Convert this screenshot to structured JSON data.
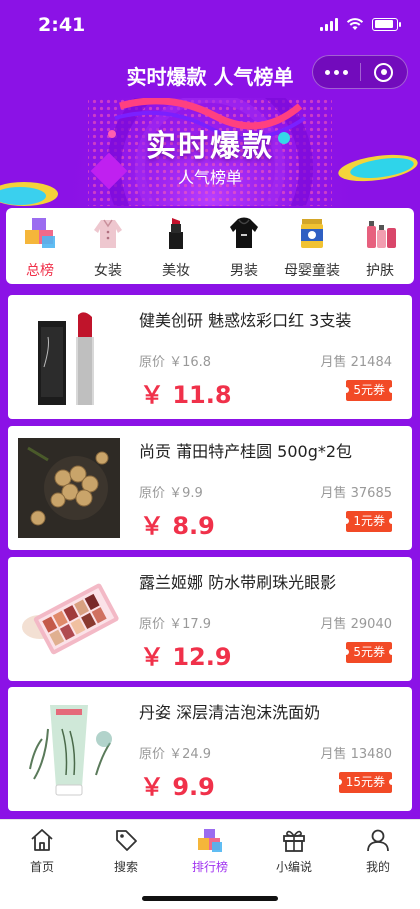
{
  "status_bar": {
    "time": "2:41"
  },
  "nav": {
    "title": "实时爆款 人气榜单"
  },
  "banner": {
    "title": "实时爆款",
    "subtitle": "人气榜单"
  },
  "categories": [
    {
      "label": "总榜",
      "active": true,
      "icon": "boxes-icon"
    },
    {
      "label": "女装",
      "active": false,
      "icon": "coat-icon"
    },
    {
      "label": "美妆",
      "active": false,
      "icon": "lipstick-icon"
    },
    {
      "label": "男装",
      "active": false,
      "icon": "hoodie-icon"
    },
    {
      "label": "母婴童装",
      "active": false,
      "icon": "formula-can-icon"
    },
    {
      "label": "护肤",
      "active": false,
      "icon": "bottles-icon"
    }
  ],
  "products": [
    {
      "name": "健美创研 魅惑炫彩口红 3支装",
      "original": "原价 ￥16.8",
      "sales": "月售 21484",
      "price": "￥ 11.8",
      "coupon": "5元券",
      "image": "lipstick-image"
    },
    {
      "name": "尚贡 莆田特产桂圆 500g*2包",
      "original": "原价 ￥9.9",
      "sales": "月售 37685",
      "price": "￥ 8.9",
      "coupon": "1元券",
      "image": "longan-image"
    },
    {
      "name": "露兰姬娜 防水带刷珠光眼影",
      "original": "原价 ￥17.9",
      "sales": "月售 29040",
      "price": "￥ 12.9",
      "coupon": "5元券",
      "image": "eyeshadow-palette-image"
    },
    {
      "name": "丹姿 深层清洁泡沫洗面奶",
      "original": "原价 ￥24.9",
      "sales": "月售 13480",
      "price": "￥ 9.9",
      "coupon": "15元券",
      "image": "facial-cleanser-image"
    }
  ],
  "tabs": [
    {
      "label": "首页",
      "active": false,
      "icon": "home-icon"
    },
    {
      "label": "搜索",
      "active": false,
      "icon": "tag-icon"
    },
    {
      "label": "排行榜",
      "active": true,
      "icon": "ranking-icon"
    },
    {
      "label": "小编说",
      "active": false,
      "icon": "gift-icon"
    },
    {
      "label": "我的",
      "active": false,
      "icon": "user-icon"
    }
  ],
  "colors": {
    "primary_purple": "#8b12e6",
    "price_red": "#f0314a",
    "coupon_orange": "#f24a26",
    "active_tab": "#a032f0"
  }
}
